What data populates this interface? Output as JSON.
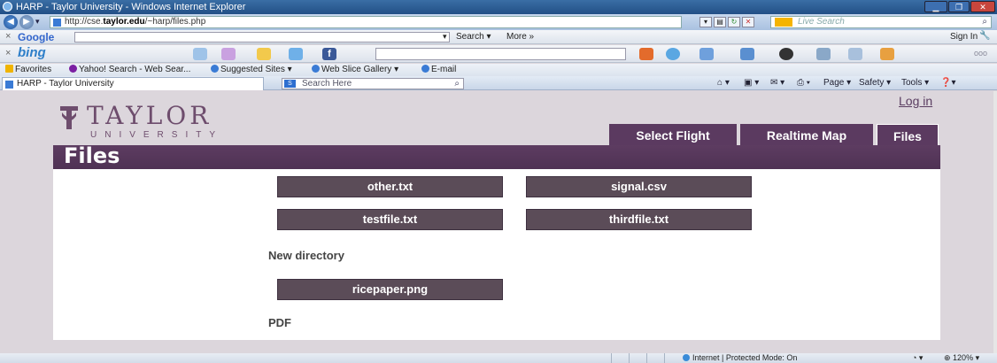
{
  "window": {
    "title": "HARP - Taylor University - Windows Internet Explorer"
  },
  "address_bar": {
    "url_prefix": "http://cse.",
    "url_host": "taylor.edu",
    "url_suffix": "/~harp/files.php",
    "live_search_placeholder": "Live Search"
  },
  "google_toolbar": {
    "logo": "Google",
    "search_label": "Search ▾",
    "more_label": "More »",
    "signin_label": "Sign In"
  },
  "bing_toolbar": {
    "logo": "bing"
  },
  "favorites_bar": {
    "items": [
      {
        "label": "Favorites"
      },
      {
        "label": "Yahoo! Search - Web Sear..."
      },
      {
        "label": "Suggested Sites ▾"
      },
      {
        "label": "Web Slice Gallery ▾"
      },
      {
        "label": "E-mail"
      }
    ]
  },
  "tab_bar": {
    "tab_title": "HARP - Taylor University",
    "search_placeholder": "Search Here",
    "commands": [
      "Page ▾",
      "Safety ▾",
      "Tools ▾"
    ]
  },
  "page": {
    "logo_name": "TAYLOR",
    "logo_sub": "UNIVERSITY",
    "login_label": "Log in",
    "nav_tabs": [
      {
        "label": "Select Flight"
      },
      {
        "label": "Realtime Map"
      },
      {
        "label": "Files"
      }
    ],
    "section_title": "Files",
    "root_files": [
      "other.txt",
      "signal.csv",
      "testfile.txt",
      "thirdfile.txt"
    ],
    "directories": [
      {
        "name": "New directory",
        "files": [
          "ricepaper.png"
        ]
      },
      {
        "name": "PDF",
        "files": []
      }
    ],
    "colors": {
      "brand_purple": "#5b3a60",
      "file_button": "#5b4c58",
      "page_bg": "#dcd6dc"
    }
  },
  "status_bar": {
    "zone": "Internet | Protected Mode: On",
    "zoom": "120%"
  }
}
